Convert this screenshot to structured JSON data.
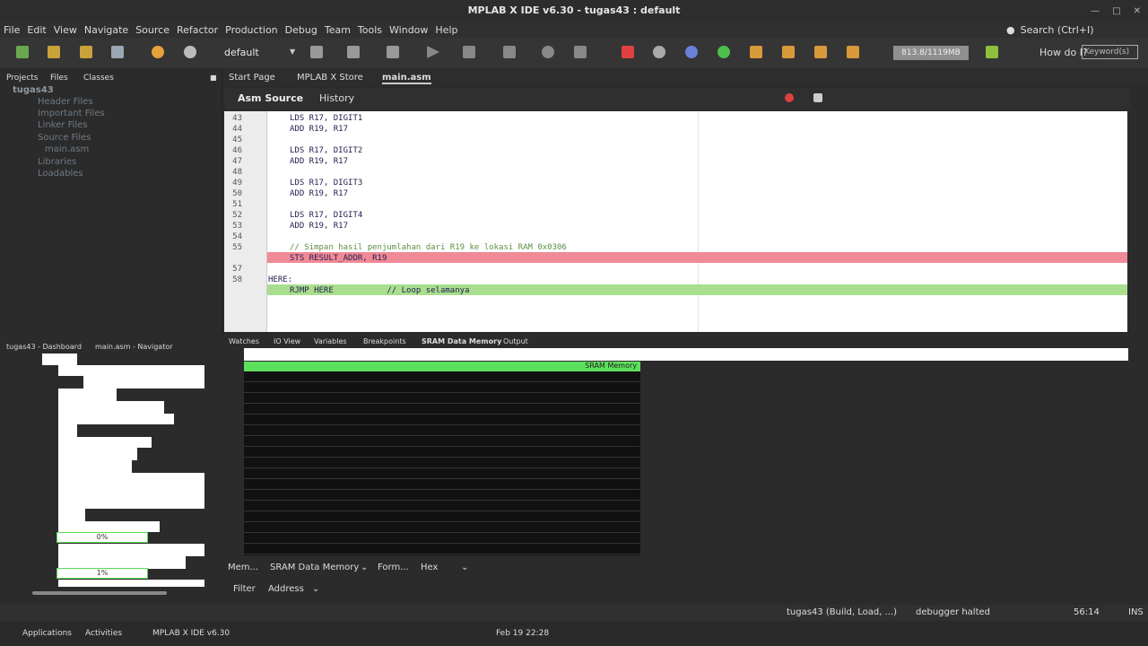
{
  "window": {
    "title": "MPLAB X IDE v6.30 - tugas43 : default"
  },
  "menu": [
    "File",
    "Edit",
    "View",
    "Navigate",
    "Source",
    "Refactor",
    "Production",
    "Debug",
    "Team",
    "Tools",
    "Window",
    "Help"
  ],
  "search": {
    "label": "Search (Ctrl+I)"
  },
  "toolbar": {
    "configuration": "default",
    "memory": "813.8/1119MB",
    "how_do_i": "How do I?",
    "keyword_placeholder": "Keyword(s)"
  },
  "projects": {
    "tabs": [
      "Projects",
      "Files",
      "Classes"
    ],
    "tree": [
      "tugas43",
      "Header Files",
      "Important Files",
      "Linker Files",
      "Source Files",
      "main.asm",
      "Libraries",
      "Loadables"
    ]
  },
  "editor": {
    "tabs": [
      "Start Page",
      "MPLAB X Store",
      "main.asm"
    ],
    "subtabs": [
      "Asm Source",
      "History"
    ],
    "lines": [
      {
        "n": "43",
        "t": "    LDS R17, DIGIT1"
      },
      {
        "n": "44",
        "t": "    ADD R19, R17"
      },
      {
        "n": "45",
        "t": ""
      },
      {
        "n": "46",
        "t": "    LDS R17, DIGIT2"
      },
      {
        "n": "47",
        "t": "    ADD R19, R17"
      },
      {
        "n": "48",
        "t": ""
      },
      {
        "n": "49",
        "t": "    LDS R17, DIGIT3"
      },
      {
        "n": "50",
        "t": "    ADD R19, R17"
      },
      {
        "n": "51",
        "t": ""
      },
      {
        "n": "52",
        "t": "    LDS R17, DIGIT4"
      },
      {
        "n": "53",
        "t": "    ADD R19, R17"
      },
      {
        "n": "54",
        "t": ""
      },
      {
        "n": "55",
        "t": "    // Simpan hasil penjumlahan dari R19 ke lokasi RAM 0x0306"
      },
      {
        "n": "",
        "t": "    STS RESULT_ADDR, R19"
      },
      {
        "n": "57",
        "t": ""
      },
      {
        "n": "58",
        "t": "HERE:"
      },
      {
        "n": "",
        "t": "    RJMP HERE           // Loop selamanya"
      }
    ]
  },
  "navigator": {
    "title": "tugas43 - Dashboard",
    "title2": "main.asm - Navigator",
    "progress1": "0%",
    "progress2": "1%"
  },
  "bottom": {
    "tabs": [
      "Watches",
      "IO View",
      "Variables",
      "Breakpoints",
      "SRAM Data Memory",
      "Output"
    ],
    "grid_label": "SRAM Memory",
    "mem_label": "Mem...",
    "mem_value": "SRAM Data Memory",
    "format_label": "Form...",
    "format_value": "Hex",
    "filter_label": "Filter",
    "filter_value": "Address"
  },
  "status": {
    "project": "tugas43 (Build, Load, ...)",
    "state": "debugger halted",
    "position": "56:14",
    "mode": "INS"
  },
  "taskbar": {
    "apps": "Applications",
    "activities": "Activities",
    "window": "MPLAB X IDE v6.30",
    "datetime": "Feb 19  22:28"
  }
}
